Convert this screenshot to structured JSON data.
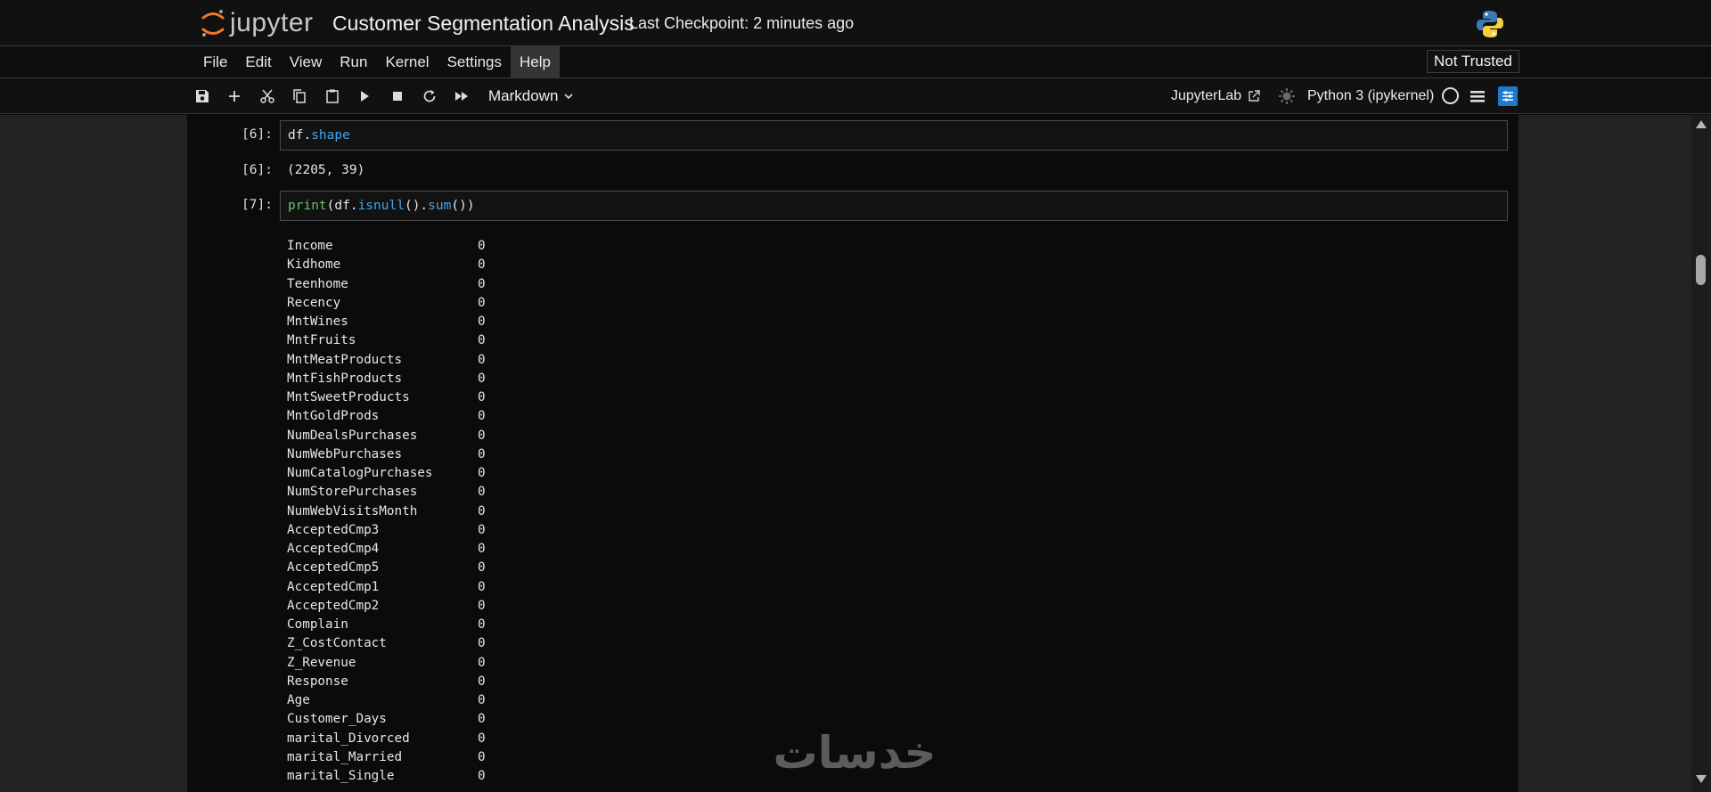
{
  "header": {
    "logo_text": "jupyter",
    "notebook_title": "Customer Segmentation Analysis",
    "checkpoint": "Last Checkpoint: 2 minutes ago"
  },
  "menu": {
    "items": [
      "File",
      "Edit",
      "View",
      "Run",
      "Kernel",
      "Settings",
      "Help"
    ],
    "trust_label": "Not Trusted"
  },
  "toolbar": {
    "cell_type": "Markdown",
    "jupyterlab_label": "JupyterLab",
    "kernel_name": "Python 3 (ipykernel)",
    "icons": [
      "save-icon",
      "add-icon",
      "cut-icon",
      "copy-icon",
      "paste-icon",
      "run-icon",
      "stop-icon",
      "restart-icon",
      "fast-forward-icon",
      "chevron-down-icon",
      "external-link-icon",
      "kernel-status-icon",
      "kernel-idle-icon",
      "menu-lines-icon",
      "settings-icon"
    ]
  },
  "cells": [
    {
      "prompt": "[6]:",
      "code_obj": "df.",
      "code_attr": "shape",
      "out_prompt": "[6]:",
      "output": "(2205, 39)"
    },
    {
      "prompt": "[7]:",
      "code_fn": "print",
      "code_mid": "(df.",
      "code_m1": "isnull",
      "code_sep": "().",
      "code_m2": "sum",
      "code_end": "())",
      "series": [
        {
          "name": "Income",
          "value": "0"
        },
        {
          "name": "Kidhome",
          "value": "0"
        },
        {
          "name": "Teenhome",
          "value": "0"
        },
        {
          "name": "Recency",
          "value": "0"
        },
        {
          "name": "MntWines",
          "value": "0"
        },
        {
          "name": "MntFruits",
          "value": "0"
        },
        {
          "name": "MntMeatProducts",
          "value": "0"
        },
        {
          "name": "MntFishProducts",
          "value": "0"
        },
        {
          "name": "MntSweetProducts",
          "value": "0"
        },
        {
          "name": "MntGoldProds",
          "value": "0"
        },
        {
          "name": "NumDealsPurchases",
          "value": "0"
        },
        {
          "name": "NumWebPurchases",
          "value": "0"
        },
        {
          "name": "NumCatalogPurchases",
          "value": "0"
        },
        {
          "name": "NumStorePurchases",
          "value": "0"
        },
        {
          "name": "NumWebVisitsMonth",
          "value": "0"
        },
        {
          "name": "AcceptedCmp3",
          "value": "0"
        },
        {
          "name": "AcceptedCmp4",
          "value": "0"
        },
        {
          "name": "AcceptedCmp5",
          "value": "0"
        },
        {
          "name": "AcceptedCmp1",
          "value": "0"
        },
        {
          "name": "AcceptedCmp2",
          "value": "0"
        },
        {
          "name": "Complain",
          "value": "0"
        },
        {
          "name": "Z_CostContact",
          "value": "0"
        },
        {
          "name": "Z_Revenue",
          "value": "0"
        },
        {
          "name": "Response",
          "value": "0"
        },
        {
          "name": "Age",
          "value": "0"
        },
        {
          "name": "Customer_Days",
          "value": "0"
        },
        {
          "name": "marital_Divorced",
          "value": "0"
        },
        {
          "name": "marital_Married",
          "value": "0"
        },
        {
          "name": "marital_Single",
          "value": "0"
        }
      ]
    }
  ],
  "watermark_text": "خدسات",
  "colors": {
    "accent": "#1a7ad0",
    "code_attribute": "#43a3e8",
    "code_builtin": "#6bc56b",
    "background": "#0b0b0b"
  }
}
